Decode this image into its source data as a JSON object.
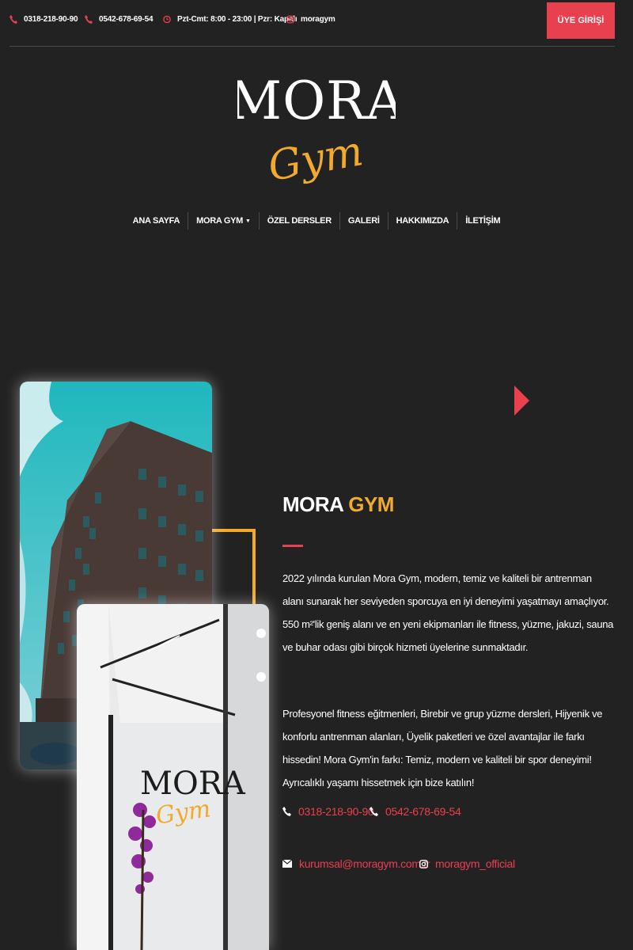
{
  "topbar": {
    "phone1": "0318-218-90-90",
    "phone2": "0542-678-69-54",
    "hours": "Pzt-Cmt: 8:00 - 23:00 | Pzr: Kapalı",
    "instagram": "moragym",
    "member_button": "ÜYE GİRİŞİ"
  },
  "logo": {
    "word1": "MORA",
    "word2": "Gym",
    "word1_color": "#ffffff",
    "word2_color": "#f2aa2d"
  },
  "nav": {
    "items": [
      {
        "label": "ANA SAYFA"
      },
      {
        "label": "MORA GYM"
      },
      {
        "label": "ÖZEL DERSLER"
      },
      {
        "label": "GALERİ"
      },
      {
        "label": "HAKKIMIZDA"
      },
      {
        "label": "İLETİŞİM"
      }
    ]
  },
  "about": {
    "title_part1": "MORA",
    "title_part2": "GYM",
    "paragraph1": "2022 yılında kurulan Mora Gym, modern, temiz ve kaliteli bir antrenman alanı sunarak her seviyeden sporcuya en iyi deneyimi yaşatmayı amaçlıyor. 550 m²'lik geniş alanı ve en yeni ekipmanları ile fitness, yüzme, jakuzi, sauna ve buhar odası gibi birçok hizmeti üyelerine sunmaktadır.",
    "paragraph2": "Profesyonel fitness eğitmenleri, Birebir ve grup yüzme dersleri, Hijyenik ve konforlu antrenman alanları, Üyelik paketleri ve özel avantajlar ile farkı hissedin! Mora Gym'in farkı: Temiz, modern ve kaliteli bir spor deneyimi! Ayrıcalıklı yaşamı hissetmek için bize katılın!",
    "contact_phone1": "0318-218-90-90",
    "contact_phone2": "0542-678-69-54",
    "contact_email": "kurumsal@moragym.com.tr",
    "contact_instagram": "moragym_official"
  },
  "colors": {
    "accent_red": "#e8404e",
    "accent_gold": "#f2aa2d",
    "background": "#232223"
  },
  "icons": [
    "phone-icon",
    "clock-icon",
    "instagram-icon",
    "email-icon",
    "play-icon"
  ]
}
